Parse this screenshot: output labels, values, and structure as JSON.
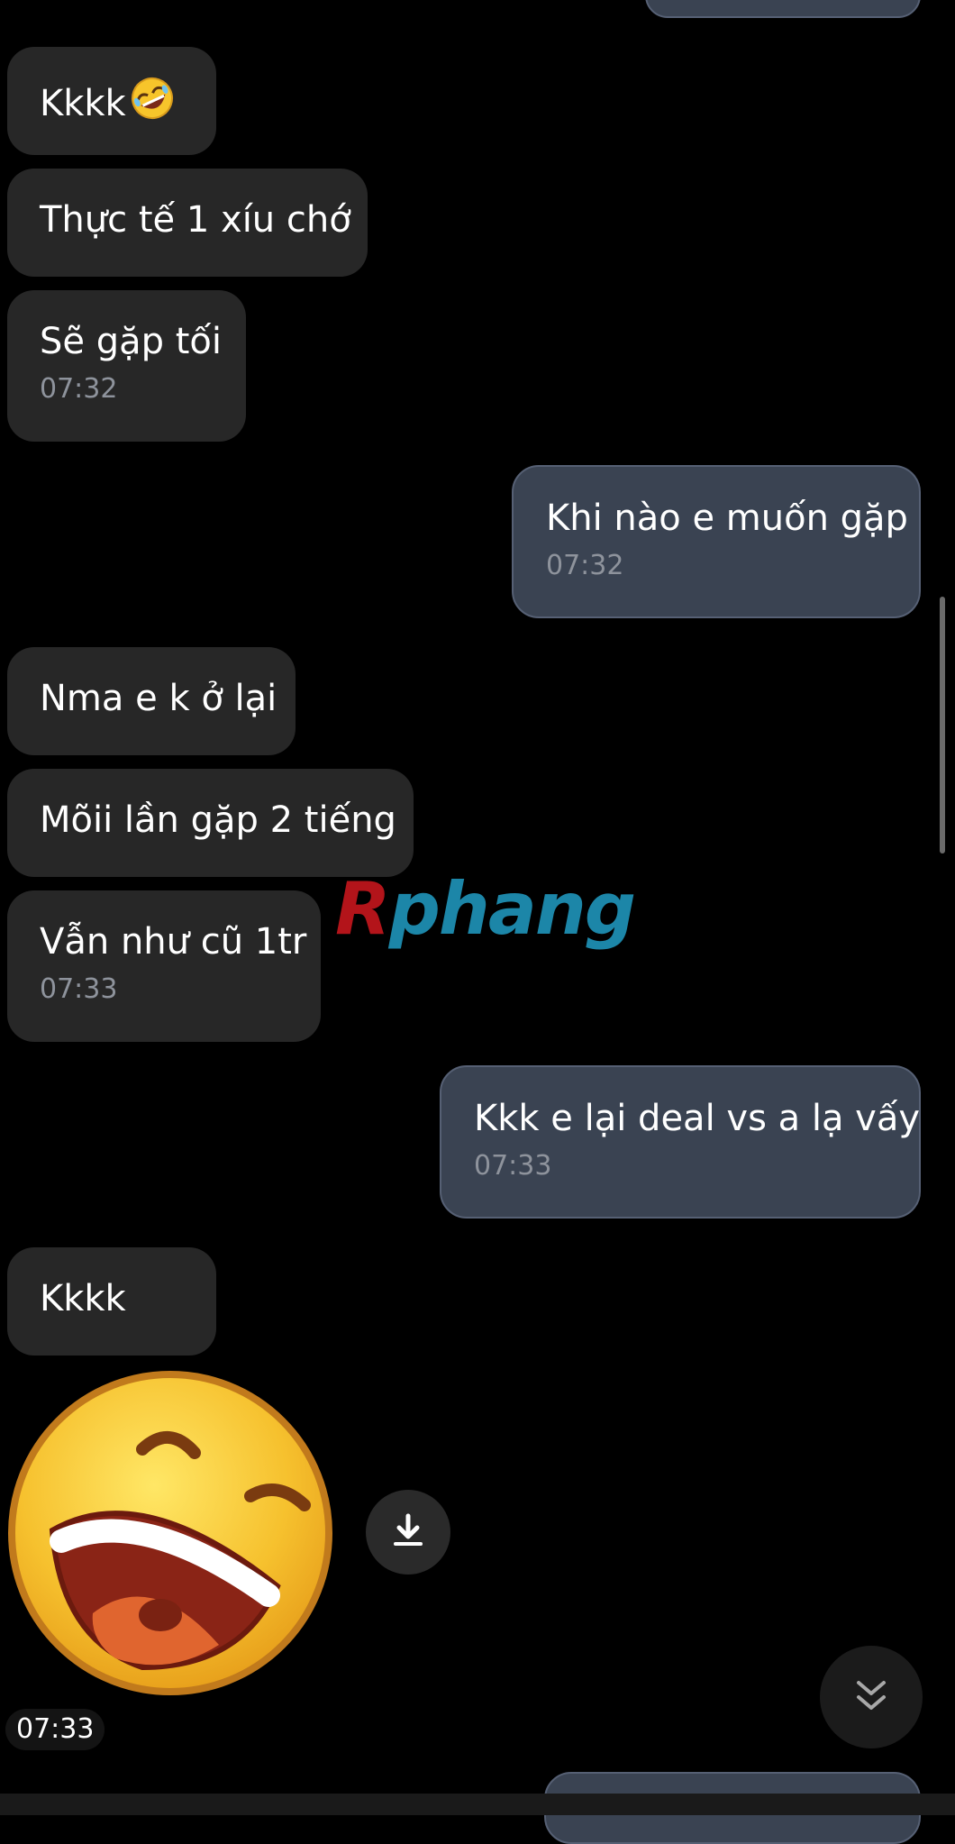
{
  "messages": [
    {
      "text": "",
      "time": ""
    },
    {
      "text": "Kkkk",
      "emoji": "rolling-on-floor-laughing-icon"
    },
    {
      "text": "Thực tế 1 xíu chớ"
    },
    {
      "text": "Sẽ gặp tối",
      "time": "07:32"
    },
    {
      "text": "Khi nào e muốn gặp",
      "time": "07:32"
    },
    {
      "text": "Nma e k ở lại"
    },
    {
      "text": "Mõii lần gặp 2 tiếng"
    },
    {
      "text": "Vẫn như cũ 1tr",
      "time": "07:33"
    },
    {
      "text": "Kkk e lại deal vs a lạ vấy",
      "time": "07:33"
    },
    {
      "text": "Kkkk"
    }
  ],
  "sticker": {
    "name": "laughing-emoji-sticker",
    "time": "07:33"
  },
  "watermark": {
    "first": "R",
    "rest": "phang"
  },
  "colors": {
    "incoming_bubble": "#272727",
    "outgoing_bubble": "#3a4352",
    "outgoing_border": "#566074",
    "timestamp": "#8e939c",
    "background": "#000000"
  }
}
